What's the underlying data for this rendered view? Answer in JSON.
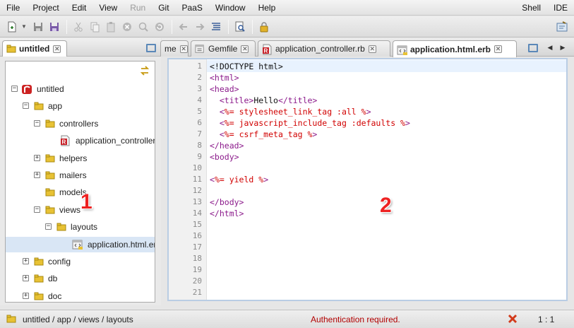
{
  "menubar": {
    "items": [
      "File",
      "Project",
      "Edit",
      "View",
      "Run",
      "Git",
      "PaaS",
      "Window",
      "Help"
    ],
    "disabled_index": 4,
    "right_items": [
      "Shell",
      "IDE"
    ]
  },
  "left_panel": {
    "tab_label": "untitled",
    "tree": [
      {
        "label": "untitled",
        "icon": "project-icon",
        "toggle": "minus",
        "level": 0
      },
      {
        "label": "app",
        "icon": "folder-icon",
        "toggle": "minus",
        "level": 1
      },
      {
        "label": "controllers",
        "icon": "folder-icon",
        "toggle": "minus",
        "level": 2
      },
      {
        "label": "application_controller.rb",
        "icon": "ruby-file-icon",
        "toggle": "",
        "level": 3
      },
      {
        "label": "helpers",
        "icon": "folder-icon",
        "toggle": "plus",
        "level": 2
      },
      {
        "label": "mailers",
        "icon": "folder-icon",
        "toggle": "plus",
        "level": 2
      },
      {
        "label": "models",
        "icon": "folder-icon",
        "toggle": "",
        "level": 2
      },
      {
        "label": "views",
        "icon": "folder-icon",
        "toggle": "minus",
        "level": 2
      },
      {
        "label": "layouts",
        "icon": "folder-icon",
        "toggle": "minus",
        "level": 3
      },
      {
        "label": "application.html.erb",
        "icon": "html-file-icon",
        "toggle": "",
        "level": 4,
        "selected": true
      },
      {
        "label": "config",
        "icon": "folder-icon",
        "toggle": "plus",
        "level": 1
      },
      {
        "label": "db",
        "icon": "folder-icon",
        "toggle": "plus",
        "level": 1
      },
      {
        "label": "doc",
        "icon": "folder-icon",
        "toggle": "plus",
        "level": 1
      }
    ],
    "marker_label": "1"
  },
  "editor": {
    "tabs": [
      {
        "label": "me",
        "icon": "",
        "active": false
      },
      {
        "label": "Gemfile",
        "icon": "text-file-icon",
        "active": false
      },
      {
        "label": "application_controller.rb",
        "icon": "ruby-file-icon",
        "active": false
      },
      {
        "label": "application.html.erb",
        "icon": "html-file-icon",
        "active": true
      }
    ],
    "line_numbers": [
      "1",
      "2",
      "3",
      "4",
      "5",
      "6",
      "7",
      "8",
      "9",
      "10",
      "11",
      "12",
      "13",
      "14",
      "15",
      "16",
      "17",
      "18",
      "19",
      "20",
      "21"
    ],
    "lines": [
      [
        [
          "doc",
          "<!DOCTYPE html>"
        ]
      ],
      [
        [
          "tag",
          "<html>"
        ]
      ],
      [
        [
          "tag",
          "<head>"
        ]
      ],
      [
        [
          "text",
          "  "
        ],
        [
          "tag",
          "<title>"
        ],
        [
          "text",
          "Hello"
        ],
        [
          "tag",
          "</title>"
        ]
      ],
      [
        [
          "text",
          "  "
        ],
        [
          "tag",
          "<"
        ],
        [
          "erb",
          "%= stylesheet_link_tag :all %"
        ],
        [
          "tag",
          ">"
        ]
      ],
      [
        [
          "text",
          "  "
        ],
        [
          "tag",
          "<"
        ],
        [
          "erb",
          "%= javascript_include_tag :defaults %"
        ],
        [
          "tag",
          ">"
        ]
      ],
      [
        [
          "text",
          "  "
        ],
        [
          "tag",
          "<"
        ],
        [
          "erb",
          "%= csrf_meta_tag %"
        ],
        [
          "tag",
          ">"
        ]
      ],
      [
        [
          "tag",
          "</head>"
        ]
      ],
      [
        [
          "tag",
          "<body>"
        ]
      ],
      [],
      [
        [
          "tag",
          "<"
        ],
        [
          "erb",
          "%= yield %"
        ],
        [
          "tag",
          ">"
        ]
      ],
      [],
      [
        [
          "tag",
          "</body>"
        ]
      ],
      [
        [
          "tag",
          "</html>"
        ]
      ]
    ],
    "marker_label": "2"
  },
  "statusbar": {
    "breadcrumb": "untitled / app / views / layouts",
    "message": "Authentication required.",
    "cursor_position": "1 : 1"
  },
  "colors": {
    "tag": "#8b1a8b",
    "erb": "#d10000",
    "folder": "#e8c234",
    "accent_blue": "#5b88b8",
    "error_red": "#b20000"
  }
}
